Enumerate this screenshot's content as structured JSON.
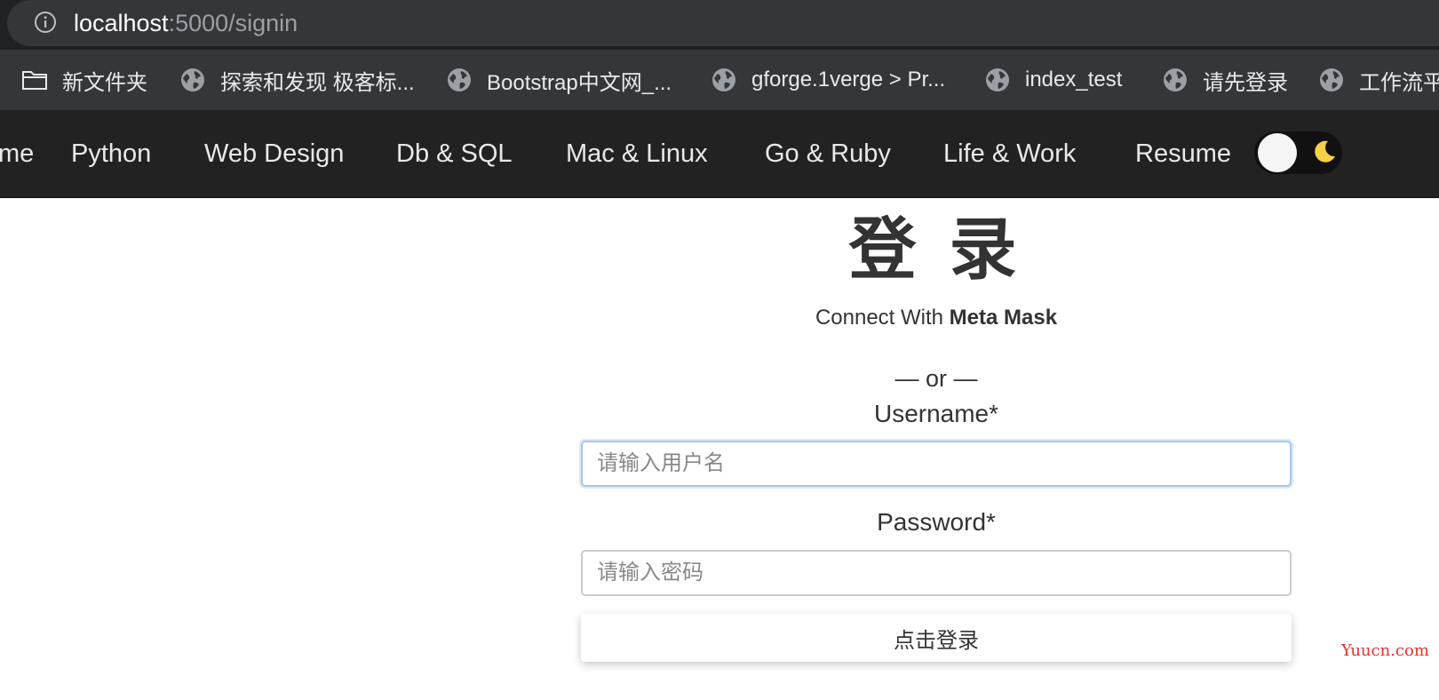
{
  "browser": {
    "url_host": "localhost",
    "url_path": ":5000/signin"
  },
  "bookmarks": [
    {
      "label": "新文件夹",
      "icon": "folder-icon"
    },
    {
      "label": "探索和发现 极客标...",
      "icon": "globe-icon"
    },
    {
      "label": "Bootstrap中文网_...",
      "icon": "globe-icon"
    },
    {
      "label": "gforge.1verge > Pr...",
      "icon": "globe-icon"
    },
    {
      "label": "index_test",
      "icon": "globe-icon"
    },
    {
      "label": "请先登录",
      "icon": "globe-icon"
    },
    {
      "label": "工作流平",
      "icon": "globe-icon"
    }
  ],
  "nav": {
    "items": [
      "me",
      "Python",
      "Web Design",
      "Db & SQL",
      "Mac & Linux",
      "Go & Ruby",
      "Life & Work",
      "Resume"
    ],
    "theme_toggle_icon": "moon-icon"
  },
  "login": {
    "title": "登 录",
    "connect_prefix": "Connect With ",
    "connect_bold": "Meta Mask",
    "or": "— or —",
    "username_label": "Username*",
    "username_placeholder": "请输入用户名",
    "password_label": "Password*",
    "password_placeholder": "请输入密码",
    "submit": "点击登录"
  },
  "watermark": "Yuucn.com",
  "colors": {
    "browser_bg": "#202124",
    "bookmarks_bg": "#35363a",
    "nav_bg": "#222222",
    "focus_border": "#a7c7ea",
    "watermark": "#e0342c"
  }
}
